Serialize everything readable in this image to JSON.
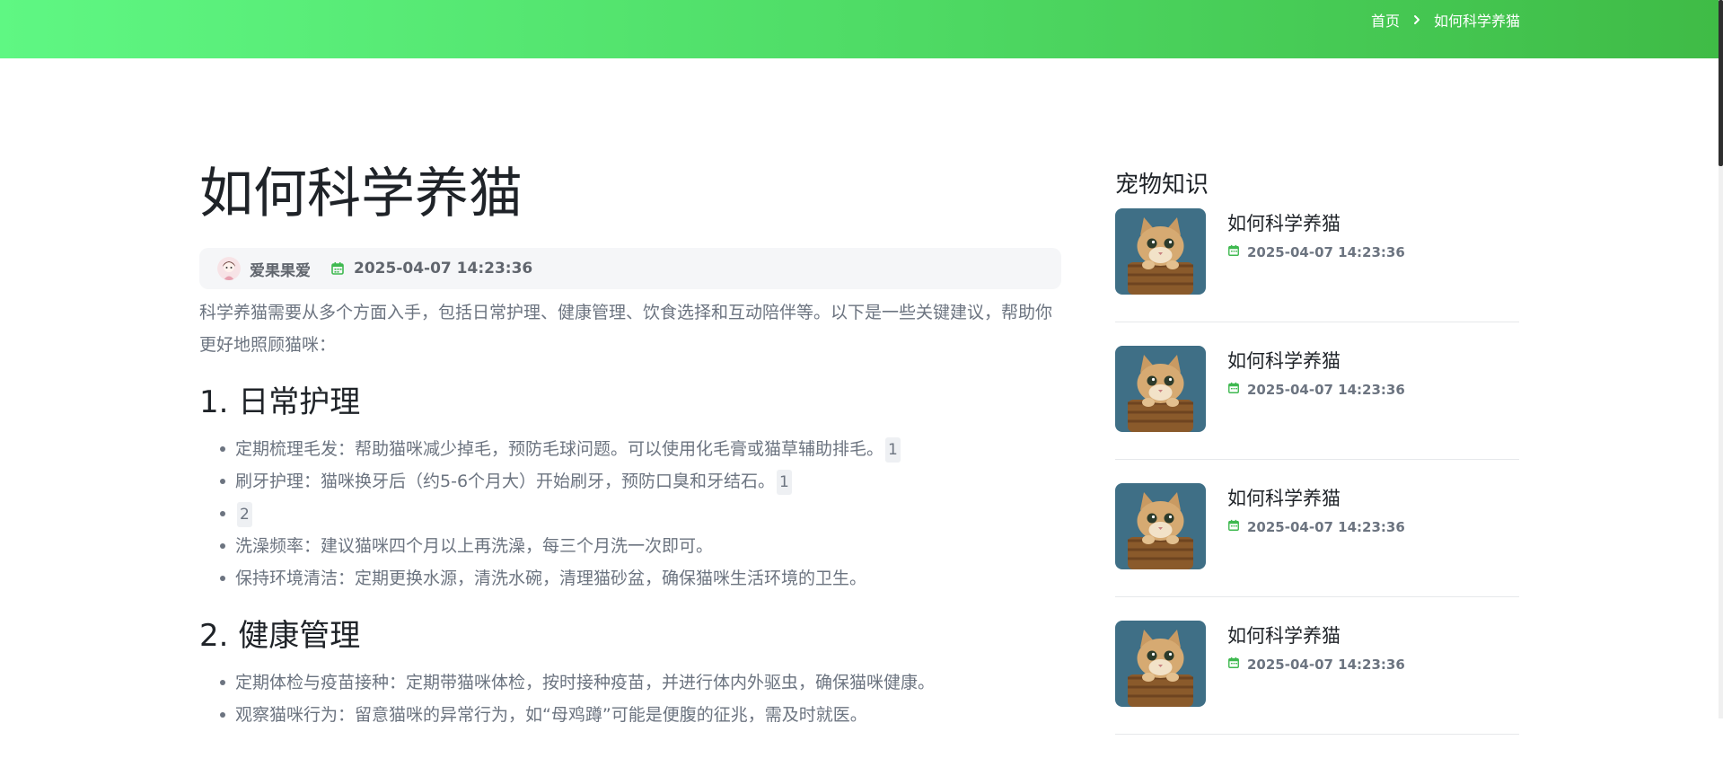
{
  "breadcrumb": {
    "home": "首页",
    "current": "如何科学养猫"
  },
  "article": {
    "title": "如何科学养猫",
    "author": "爱果果爱",
    "date": "2025-04-07 14:23:36",
    "intro": "科学养猫需要从多个方面入手，包括日常护理、健康管理、饮食选择和互动陪伴等。以下是一些关键建议，帮助你更好地照顾猫咪：",
    "sections": [
      {
        "title": "1. 日常护理",
        "items": [
          {
            "text": "定期梳理毛发：帮助猫咪减少掉毛，预防毛球问题。可以使用化毛膏或猫草辅助排毛。",
            "ref": "1"
          },
          {
            "text": "刷牙护理：猫咪换牙后（约5-6个月大）开始刷牙，预防口臭和牙结石。",
            "ref": "1"
          },
          {
            "text": "",
            "ref": "2"
          },
          {
            "text": "洗澡频率：建议猫咪四个月以上再洗澡，每三个月洗一次即可。",
            "ref": ""
          },
          {
            "text": "保持环境清洁：定期更换水源，清洗水碗，清理猫砂盆，确保猫咪生活环境的卫生。",
            "ref": ""
          }
        ]
      },
      {
        "title": "2. 健康管理",
        "items": [
          {
            "text": "定期体检与疫苗接种：定期带猫咪体检，按时接种疫苗，并进行体内外驱虫，确保猫咪健康。",
            "ref": ""
          },
          {
            "text": "观察猫咪行为：留意猫咪的异常行为，如“母鸡蹲”可能是便腹的征兆，需及时就医。",
            "ref": ""
          }
        ]
      }
    ]
  },
  "sidebar": {
    "title": "宠物知识",
    "cards": [
      {
        "title": "如何科学养猫",
        "date": "2025-04-07 14:23:36"
      },
      {
        "title": "如何科学养猫",
        "date": "2025-04-07 14:23:36"
      },
      {
        "title": "如何科学养猫",
        "date": "2025-04-07 14:23:36"
      },
      {
        "title": "如何科学养猫",
        "date": "2025-04-07 14:23:36"
      }
    ]
  },
  "colors": {
    "accent_green": "#3fb950",
    "header_gradient_start": "#5ff783",
    "header_gradient_end": "#3fbb46"
  },
  "icons": {
    "breadcrumb_separator": "chevron-right-icon",
    "date": "calendar-icon",
    "author": "avatar-icon",
    "thumbnail": "cat-photo"
  }
}
